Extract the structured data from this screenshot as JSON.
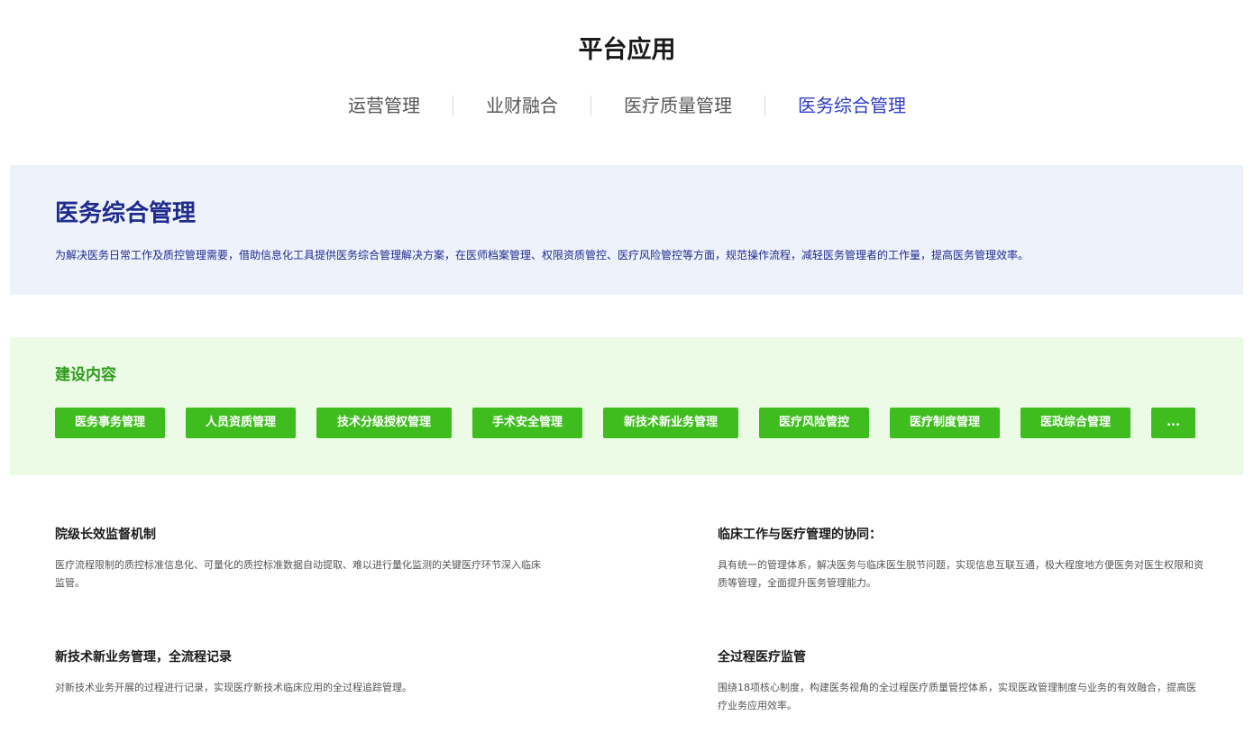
{
  "page_title": "平台应用",
  "tabs": [
    {
      "label": "运营管理"
    },
    {
      "label": "业财融合"
    },
    {
      "label": "医疗质量管理"
    },
    {
      "label": "医务综合管理"
    }
  ],
  "active_tab": "医务综合管理",
  "intro": {
    "title": "医务综合管理",
    "description": "为解决医务日常工作及质控管理需要，借助信息化工具提供医务综合管理解决方案，在医师档案管理、权限资质管控、医疗风险管控等方面，规范操作流程，减轻医务管理者的工作量，提高医务管理效率。"
  },
  "build": {
    "title": "建设内容",
    "chips": [
      {
        "label": "医务事务管理"
      },
      {
        "label": "人员资质管理"
      },
      {
        "label": "技术分级授权管理"
      },
      {
        "label": "手术安全管理"
      },
      {
        "label": "新技术新业务管理"
      },
      {
        "label": "医疗风险管控"
      },
      {
        "label": "医疗制度管理"
      },
      {
        "label": "医政综合管理"
      },
      {
        "label": "..."
      }
    ]
  },
  "features": [
    {
      "title": "院级长效监督机制",
      "description": "医疗流程限制的质控标准信息化、可量化的质控标准数据自动提取、难以进行量化监测的关键医疗环节深入临床监管。"
    },
    {
      "title": "临床工作与医疗管理的协同：",
      "description": "具有统一的管理体系，解决医务与临床医生脱节问题，实现信息互联互通，极大程度地方便医务对医生权限和资质等管理，全面提升医务管理能力。"
    },
    {
      "title": "新技术新业务管理，全流程记录",
      "description": "对新技术业务开展的过程进行记录，实现医疗新技术临床应用的全过程追踪管理。"
    },
    {
      "title": "全过程医疗监管",
      "description": "围绕18项核心制度，构建医务视角的全过程医疗质量管控体系，实现医政管理制度与业务的有效融合，提高医疗业务应用效率。"
    }
  ],
  "colors": {
    "accent": "#2d3bc7",
    "intro_bg": "#eef2fb",
    "intro_text": "#1f2a8f",
    "build_bg": "#ebfbe6",
    "build_title": "#2e9c1b",
    "chip_bg": "#3fbd1f"
  }
}
